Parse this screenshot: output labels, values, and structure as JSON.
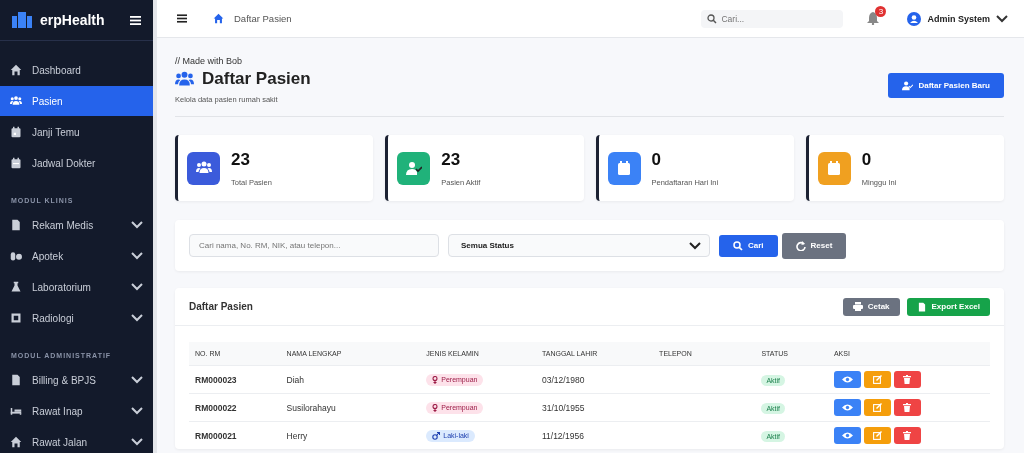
{
  "sidebar": {
    "brand": "erpHealth",
    "sections": [
      {
        "items": [
          {
            "label": "Dashboard",
            "kind": "link",
            "selected": false
          },
          {
            "label": "Pasien",
            "kind": "link",
            "selected": true
          },
          {
            "label": "Janji Temu",
            "kind": "link",
            "selected": false
          },
          {
            "label": "Jadwal Dokter",
            "kind": "link",
            "selected": false
          }
        ]
      },
      {
        "title": "MODUL KLINIS",
        "items": [
          {
            "label": "Rekam Medis",
            "kind": "menu",
            "selected": false
          },
          {
            "label": "Apotek",
            "kind": "menu",
            "selected": false
          },
          {
            "label": "Laboratorium",
            "kind": "menu",
            "selected": false
          },
          {
            "label": "Radiologi",
            "kind": "menu",
            "selected": false
          }
        ]
      },
      {
        "title": "MODUL ADMINISTRATIF",
        "items": [
          {
            "label": "Billing & BPJS",
            "kind": "menu",
            "selected": false
          },
          {
            "label": "Rawat Inap",
            "kind": "menu",
            "selected": false
          },
          {
            "label": "Rawat Jalan",
            "kind": "menu",
            "selected": false
          }
        ]
      }
    ]
  },
  "topbar": {
    "breadcrumb": "Daftar Pasien",
    "search": {
      "placeholder": "Cari..."
    },
    "notifications": "3",
    "user": "Admin System"
  },
  "header": {
    "note": "// Made with Bob",
    "title": "Daftar Pasien",
    "subtitle": "Kelola data pasien rumah sakit",
    "button": "Daftar Pasien Baru"
  },
  "stats": [
    {
      "value": "23",
      "label": "Total Pasien",
      "color": "#3b5bdb"
    },
    {
      "value": "23",
      "label": "Pasien Aktif",
      "color": "#20b27a"
    },
    {
      "value": "0",
      "label": "Pendaftaran Hari Ini",
      "color": "#3b82f6"
    },
    {
      "value": "0",
      "label": "Minggu Ini",
      "color": "#f0a020"
    }
  ],
  "filter": {
    "placeholder": "Cari nama, No. RM, NIK, atau telepon...",
    "status": "Semua Status",
    "search_button": "Cari",
    "reset_button": "Reset"
  },
  "table": {
    "title": "Daftar Pasien",
    "print_button": "Cetak",
    "export_button": "Export Excel",
    "columns": [
      "NO. RM",
      "NAMA LENGKAP",
      "JENIS KELAMIN",
      "TANGGAL LAHIR",
      "TELEPON",
      "STATUS",
      "AKSI"
    ],
    "rows": [
      {
        "rm": "RM000023",
        "name": "Diah",
        "gender": "Perempuan",
        "kind": "female",
        "birth": "03/12/1980",
        "status": "Aktif"
      },
      {
        "rm": "RM000022",
        "name": "Susilorahayu",
        "gender": "Perempuan",
        "kind": "female",
        "birth": "31/10/1955",
        "status": "Aktif"
      },
      {
        "rm": "RM000021",
        "name": "Herry",
        "gender": "Laki-laki",
        "kind": "male",
        "birth": "11/12/1956",
        "status": "Aktif"
      }
    ]
  }
}
